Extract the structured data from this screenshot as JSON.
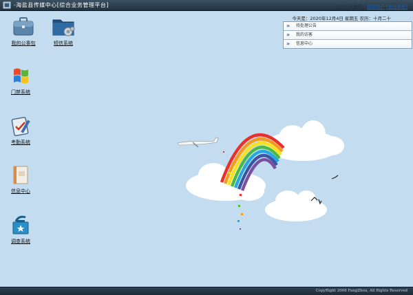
{
  "header": {
    "title": "-海盐县传媒中心[综合业务管理平台]",
    "user_prefix": "工号：0 姓名：",
    "user_name": "超级用户",
    "logout_label": "[退出系统]"
  },
  "date_line": "今天是：2020年12月4日 星期五   农历：十月二十",
  "desktop_icons": [
    {
      "label": "我的公事包",
      "icon": "briefcase-icon"
    },
    {
      "label": "短信系统",
      "icon": "gear-folder-icon"
    },
    {
      "label": "门禁系统",
      "icon": "windows-logo-icon"
    },
    {
      "label": "考勤系统",
      "icon": "clipboard-check-icon"
    },
    {
      "label": "信息中心",
      "icon": "document-icon"
    },
    {
      "label": "调查系统",
      "icon": "ballot-box-icon"
    }
  ],
  "notice_panel": {
    "items": [
      {
        "label": "待处理公告"
      },
      {
        "label": "我的访客"
      },
      {
        "label": "信息中心"
      }
    ],
    "arrow_glyph": "»"
  },
  "footer": {
    "copyright": "CopyRight 2008 FangZhou, All Rights Reserved"
  },
  "colors": {
    "background": "#c3dcef",
    "topbar": "#2c3e4e",
    "link": "#1a5fb4"
  }
}
